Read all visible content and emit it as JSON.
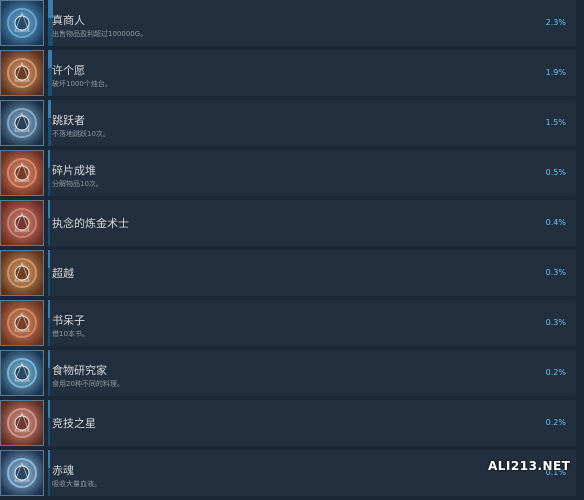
{
  "achievements": [
    {
      "title": "真商人",
      "desc": "出售物品盈利超过100000G。",
      "percent": "2.3%",
      "fill": 0.023,
      "icon": "coin-spiral-icon",
      "colors": [
        "#1a3a5a",
        "#6fb3e0"
      ]
    },
    {
      "title": "许个愿",
      "desc": "破坏1000个烛台。",
      "percent": "1.9%",
      "fill": 0.019,
      "icon": "candles-icon",
      "colors": [
        "#5a2e1a",
        "#e0a070"
      ]
    },
    {
      "title": "跳跃者",
      "desc": "不落地跳跃10次。",
      "percent": "1.5%",
      "fill": 0.015,
      "icon": "leaping-figure-icon",
      "colors": [
        "#1b2e45",
        "#8fb8d8"
      ]
    },
    {
      "title": "碎片成堆",
      "desc": "分解物品10次。",
      "percent": "0.5%",
      "fill": 0.005,
      "icon": "shards-icon",
      "colors": [
        "#6a2e1e",
        "#e89070"
      ]
    },
    {
      "title": "执念的炼金术士",
      "desc": "",
      "percent": "0.4%",
      "fill": 0.004,
      "icon": "alchemist-icon",
      "colors": [
        "#6b2b22",
        "#d88878"
      ]
    },
    {
      "title": "超越",
      "desc": "",
      "percent": "0.3%",
      "fill": 0.003,
      "icon": "transcend-figure-icon",
      "colors": [
        "#5e3318",
        "#dda070"
      ]
    },
    {
      "title": "书呆子",
      "desc": "借10本书。",
      "percent": "0.3%",
      "fill": 0.003,
      "icon": "books-icon",
      "colors": [
        "#6a3220",
        "#e09068"
      ]
    },
    {
      "title": "食物研究家",
      "desc": "食用20种不同的料理。",
      "percent": "0.2%",
      "fill": 0.002,
      "icon": "food-plate-icon",
      "colors": [
        "#1a3550",
        "#86c6e8"
      ]
    },
    {
      "title": "竞技之星",
      "desc": "",
      "percent": "0.2%",
      "fill": 0.002,
      "icon": "arena-star-icon",
      "colors": [
        "#5e2a22",
        "#e0a090"
      ]
    },
    {
      "title": "赤魂",
      "desc": "吸收大量血液。",
      "percent": "0.1%",
      "fill": 0.001,
      "icon": "crimson-lips-icon",
      "colors": [
        "#1d3350",
        "#9cc8e8"
      ]
    }
  ],
  "watermark": "ALI213.NET"
}
